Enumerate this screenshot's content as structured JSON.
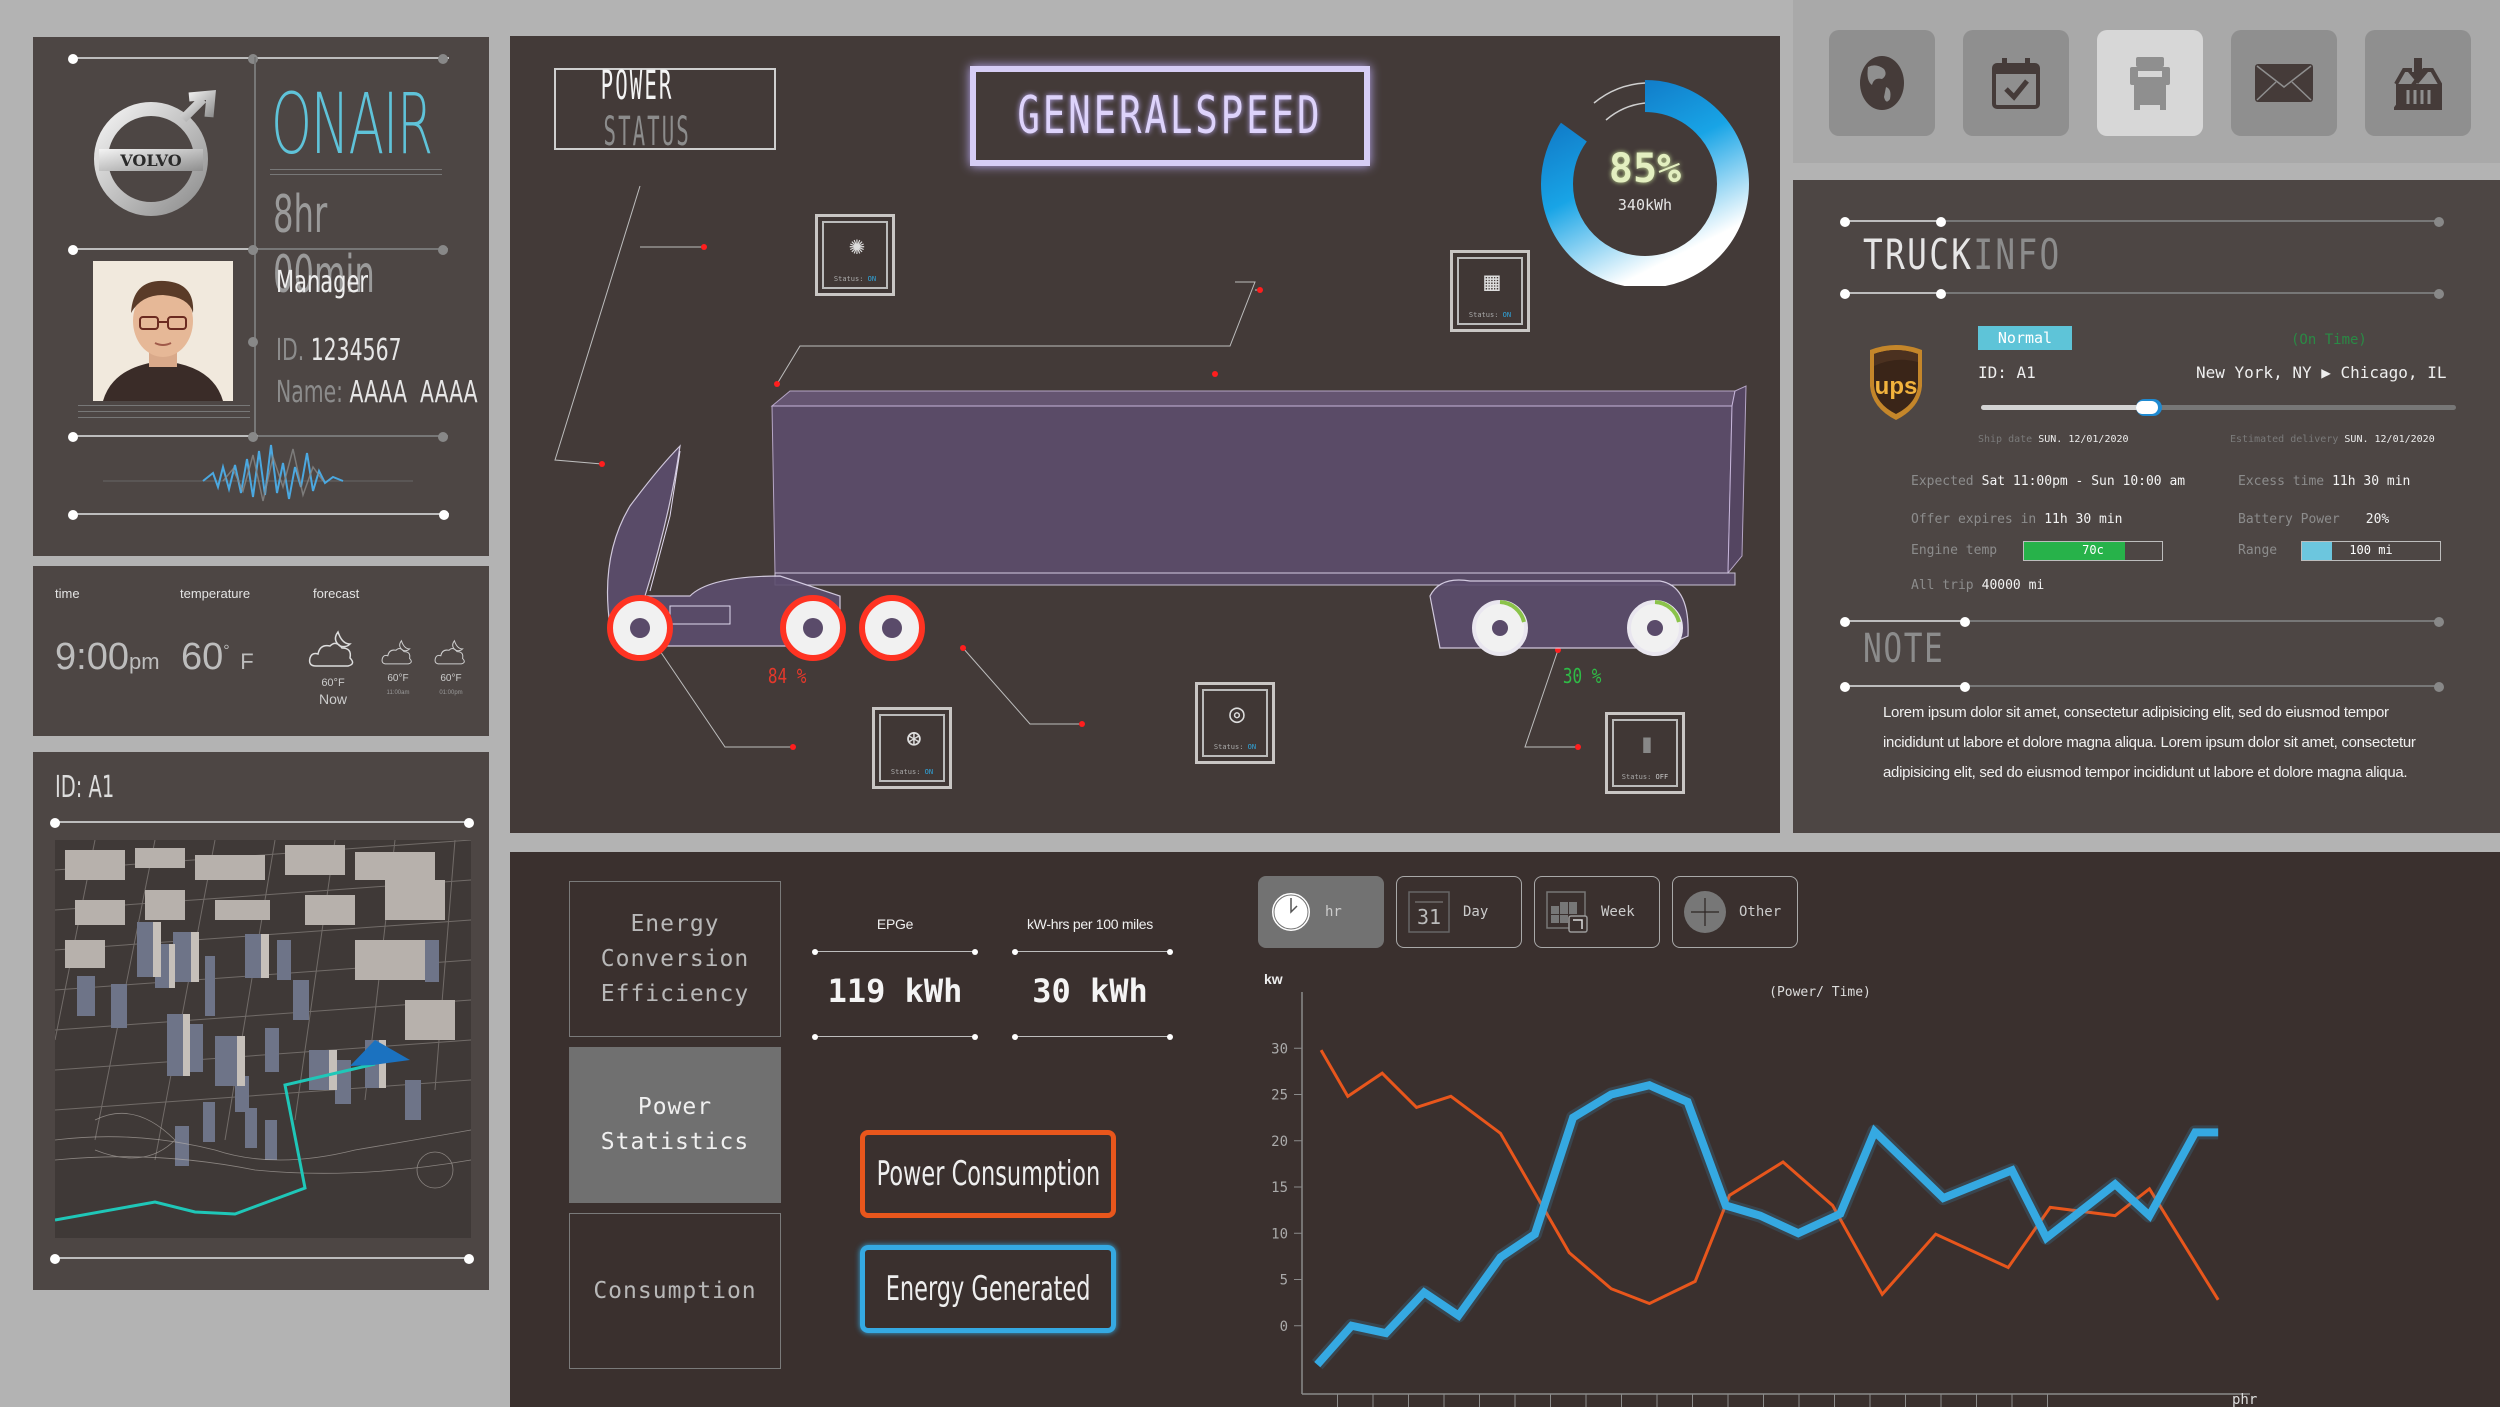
{
  "profile": {
    "brand": "VOLVO",
    "status_title": "ONAIR",
    "duration": "8hr 00min",
    "role": "Manager",
    "id_label": "ID.",
    "id_value": "1234567",
    "name_label": "Name:",
    "name_value": "AAAA  AAAA"
  },
  "weather": {
    "time_label": "time",
    "temperature_label": "temperature",
    "forecast_label": "forecast",
    "time_value": "9:00",
    "time_suffix": "pm",
    "temp_value": "60",
    "temp_unit": "F",
    "forecast": [
      {
        "temp": "60°F",
        "label": "Now",
        "icon": "cloud-moon-icon"
      },
      {
        "temp": "60°F",
        "label": "11:00am",
        "icon": "cloud-moon-icon"
      },
      {
        "temp": "60°F",
        "label": "01:00pm",
        "icon": "cloud-moon-icon"
      }
    ]
  },
  "map": {
    "title": "ID: A1",
    "route_color": "#1fc7b8",
    "marker_color": "#1b72c0"
  },
  "power": {
    "title_a": "POWER",
    "title_b": "STATUS",
    "speed_title": "GENERALSPEED",
    "battery_pct": 85,
    "battery_pct_label": "85%",
    "battery_energy": "340kWh",
    "front_wheels_pct": "84 %",
    "rear_wheels_pct": "30 %",
    "status_boxes": [
      {
        "icon": "fan-icon",
        "label": "Status:",
        "state": "ON"
      },
      {
        "icon": "solar-panel-icon",
        "label": "Status:",
        "state": "ON"
      },
      {
        "icon": "tire-pressure-icon",
        "label": "Status:",
        "state": "ON"
      },
      {
        "icon": "brake-disc-icon",
        "label": "Status:",
        "state": "ON"
      },
      {
        "icon": "battery-recycle-icon",
        "label": "Status:",
        "state": "OFF"
      }
    ]
  },
  "nav": {
    "items": [
      {
        "name": "globe",
        "icon": "globe-icon",
        "active": false
      },
      {
        "name": "calendar",
        "icon": "calendar-check-icon",
        "active": false
      },
      {
        "name": "truck",
        "icon": "truck-icon",
        "active": true
      },
      {
        "name": "mail",
        "icon": "mail-icon",
        "active": false
      },
      {
        "name": "inbox",
        "icon": "inbox-download-icon",
        "active": false
      }
    ]
  },
  "truck_info": {
    "title_a": "TRUCK",
    "title_b": "INFO",
    "carrier": "ups",
    "status_badge": "Normal",
    "on_time": "(On Time)",
    "id": "ID: A1",
    "route": "New York, NY ▶ Chicago, IL",
    "progress": 0.35,
    "ship_date_label": "Ship date",
    "ship_date": "SUN. 12/01/2020",
    "delivery_label": "Estimated delivery",
    "delivery_date": "SUN. 12/01/2020",
    "expected_label": "Expected",
    "expected": "Sat 11:00pm - Sun 10:00 am",
    "excess_label": "Excess time",
    "excess": "11h 30 min",
    "offer_label": "Offer expires in",
    "offer": "11h 30 min",
    "battery_label": "Battery Power",
    "battery": "20%",
    "engine_label": "Engine temp",
    "engine": "70c",
    "engine_fill": 0.73,
    "range_label": "Range",
    "range": "100 mi",
    "range_fill": 0.22,
    "trip_label": "All trip",
    "trip": "40000 mi",
    "note_title": "NOTE",
    "note_body": "Lorem ipsum dolor sit amet, consectetur adipisicing elit, sed do eiusmod tempor incididunt ut labore et dolore magna aliqua. Lorem ipsum dolor sit amet, consectetur adipisicing elit, sed do eiusmod tempor incididunt ut labore et dolore magna aliqua."
  },
  "stats": {
    "tabs": [
      {
        "label": "Energy\nConversion\nEfficiency",
        "active": false
      },
      {
        "label": "Power\nStatistics",
        "active": true
      },
      {
        "label": "Consumption",
        "active": false
      }
    ],
    "metrics": [
      {
        "label": "EPGe",
        "value": "119 kWh"
      },
      {
        "label": "kW-hrs per 100 miles",
        "value": "30 kWh"
      }
    ],
    "legend": [
      {
        "label": "Power Consumption",
        "color": "#e8561c"
      },
      {
        "label": "Energy Generated",
        "color": "#35a9e2"
      }
    ],
    "ranges": [
      {
        "label": "hr",
        "icon": "clock-icon",
        "active": true
      },
      {
        "label": "Day",
        "icon": "calendar-31-icon",
        "active": false
      },
      {
        "label": "Week",
        "icon": "calendar-week-icon",
        "active": false
      },
      {
        "label": "Other",
        "icon": "plus-icon",
        "active": false
      }
    ]
  },
  "chart_data": {
    "type": "line",
    "title": "(Power/ Time)",
    "xlabel": "phr",
    "ylabel": "kw",
    "ylim": [
      -5,
      35
    ],
    "yticks": [
      0,
      5,
      10,
      15,
      20,
      25,
      30
    ],
    "xlim": [
      0,
      23
    ],
    "xtick_count": 21,
    "grid": false,
    "legend": "left",
    "series": [
      {
        "name": "Power Consumption",
        "color": "#e8561c",
        "x": [
          0.5,
          1.2,
          2.1,
          3.0,
          3.9,
          5.2,
          7.0,
          8.1,
          9.1,
          10.3,
          11.2,
          12.6,
          13.9,
          15.2,
          16.6,
          18.5,
          19.6,
          21.3,
          22.2,
          24.0
        ],
        "values": [
          29.8,
          24.8,
          27.3,
          23.6,
          24.8,
          20.8,
          7.9,
          4.0,
          2.4,
          4.8,
          14.1,
          17.7,
          13.0,
          3.4,
          9.9,
          6.3,
          12.8,
          11.9,
          14.8,
          2.8
        ]
      },
      {
        "name": "Energy Generated",
        "color": "#35a9e2",
        "x": [
          0.4,
          1.3,
          2.2,
          3.2,
          4.1,
          5.2,
          6.1,
          7.1,
          8.1,
          9.1,
          10.1,
          11.1,
          12.0,
          13.0,
          14.1,
          15.0,
          16.8,
          18.6,
          19.5,
          21.3,
          22.2,
          23.4,
          24.0
        ],
        "values": [
          -4.2,
          0.0,
          -0.8,
          3.6,
          1.1,
          7.4,
          9.9,
          22.5,
          25.0,
          26.0,
          24.2,
          13.0,
          11.9,
          10.0,
          12.1,
          21.0,
          13.8,
          16.8,
          9.5,
          15.3,
          11.9,
          20.9,
          20.9
        ]
      }
    ]
  }
}
